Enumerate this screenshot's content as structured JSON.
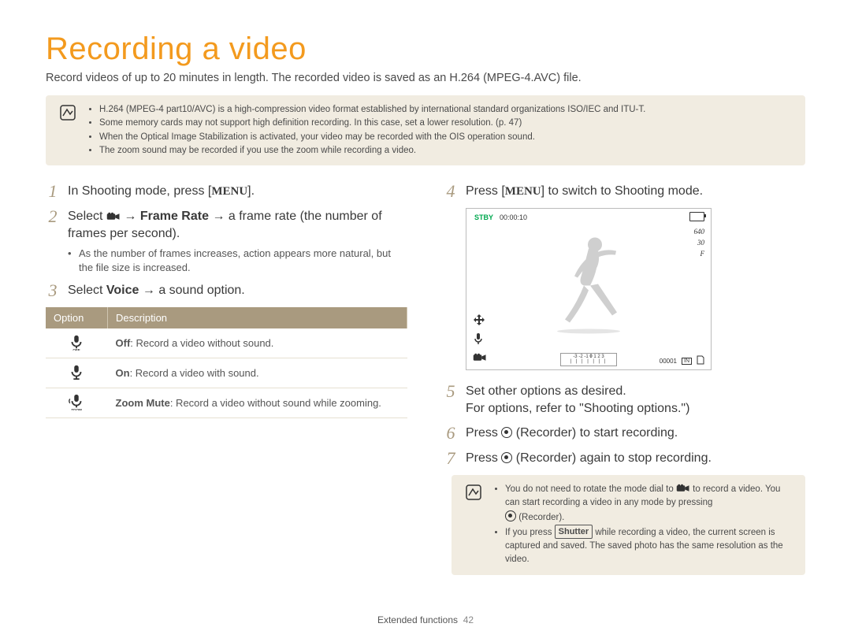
{
  "title": "Recording a video",
  "intro": "Record videos of up to 20 minutes in length. The recorded video is saved as an H.264 (MPEG-4.AVC) file.",
  "top_notes": [
    "H.264 (MPEG-4 part10/AVC) is a high-compression video format established by international standard organizations ISO/IEC and ITU-T.",
    "Some memory cards may not support high definition recording. In this case, set a lower resolution. (p. 47)",
    "When the Optical Image Stabilization is activated, your video may be recorded with the OIS operation sound.",
    "The zoom sound may be recorded if you use the zoom while recording a video."
  ],
  "steps": {
    "s1_a": "In Shooting mode, press [",
    "s1_menu": "MENU",
    "s1_b": "].",
    "s2_a": "Select ",
    "s2_arrow": " → ",
    "s2_b": "Frame Rate",
    "s2_c": " → a frame rate (the number of frames per second).",
    "s2_sub": "As the number of frames increases, action appears more natural, but the file size is increased.",
    "s3_a": "Select ",
    "s3_b": "Voice",
    "s3_c": " → a sound option.",
    "s4_a": "Press [",
    "s4_menu": "MENU",
    "s4_b": "] to switch to Shooting mode.",
    "s5_a": "Set other options as desired.",
    "s5_b": "For options, refer to \"Shooting options.\")",
    "s6_a": "Press ",
    "s6_b": " (Recorder) to start recording.",
    "s7_a": "Press ",
    "s7_b": " (Recorder) again to stop recording."
  },
  "table": {
    "h_option": "Option",
    "h_desc": "Description",
    "r1_label": "Off",
    "r1_text": ": Record a video without sound.",
    "r2_label": "On",
    "r2_text": ": Record a video with sound.",
    "r3_label": "Zoom Mute",
    "r3_text": ": Record a video without sound while zooming."
  },
  "preview": {
    "stby": "STBY",
    "time": "00:00:10",
    "res": "640",
    "fps": "30",
    "flash": "F",
    "counter": "00001",
    "card": "IN"
  },
  "bottom_notes": {
    "n1_a": "You do not need to rotate the mode dial to ",
    "n1_b": " to record a video. You can start recording a video in any mode by pressing ",
    "n1_c": " (Recorder).",
    "n2_a": "If you press ",
    "n2_shutter": "Shutter",
    "n2_b": " while recording a video, the current screen is captured and saved. The saved photo has the same resolution as the video."
  },
  "footer_label": "Extended functions",
  "footer_page": "42"
}
